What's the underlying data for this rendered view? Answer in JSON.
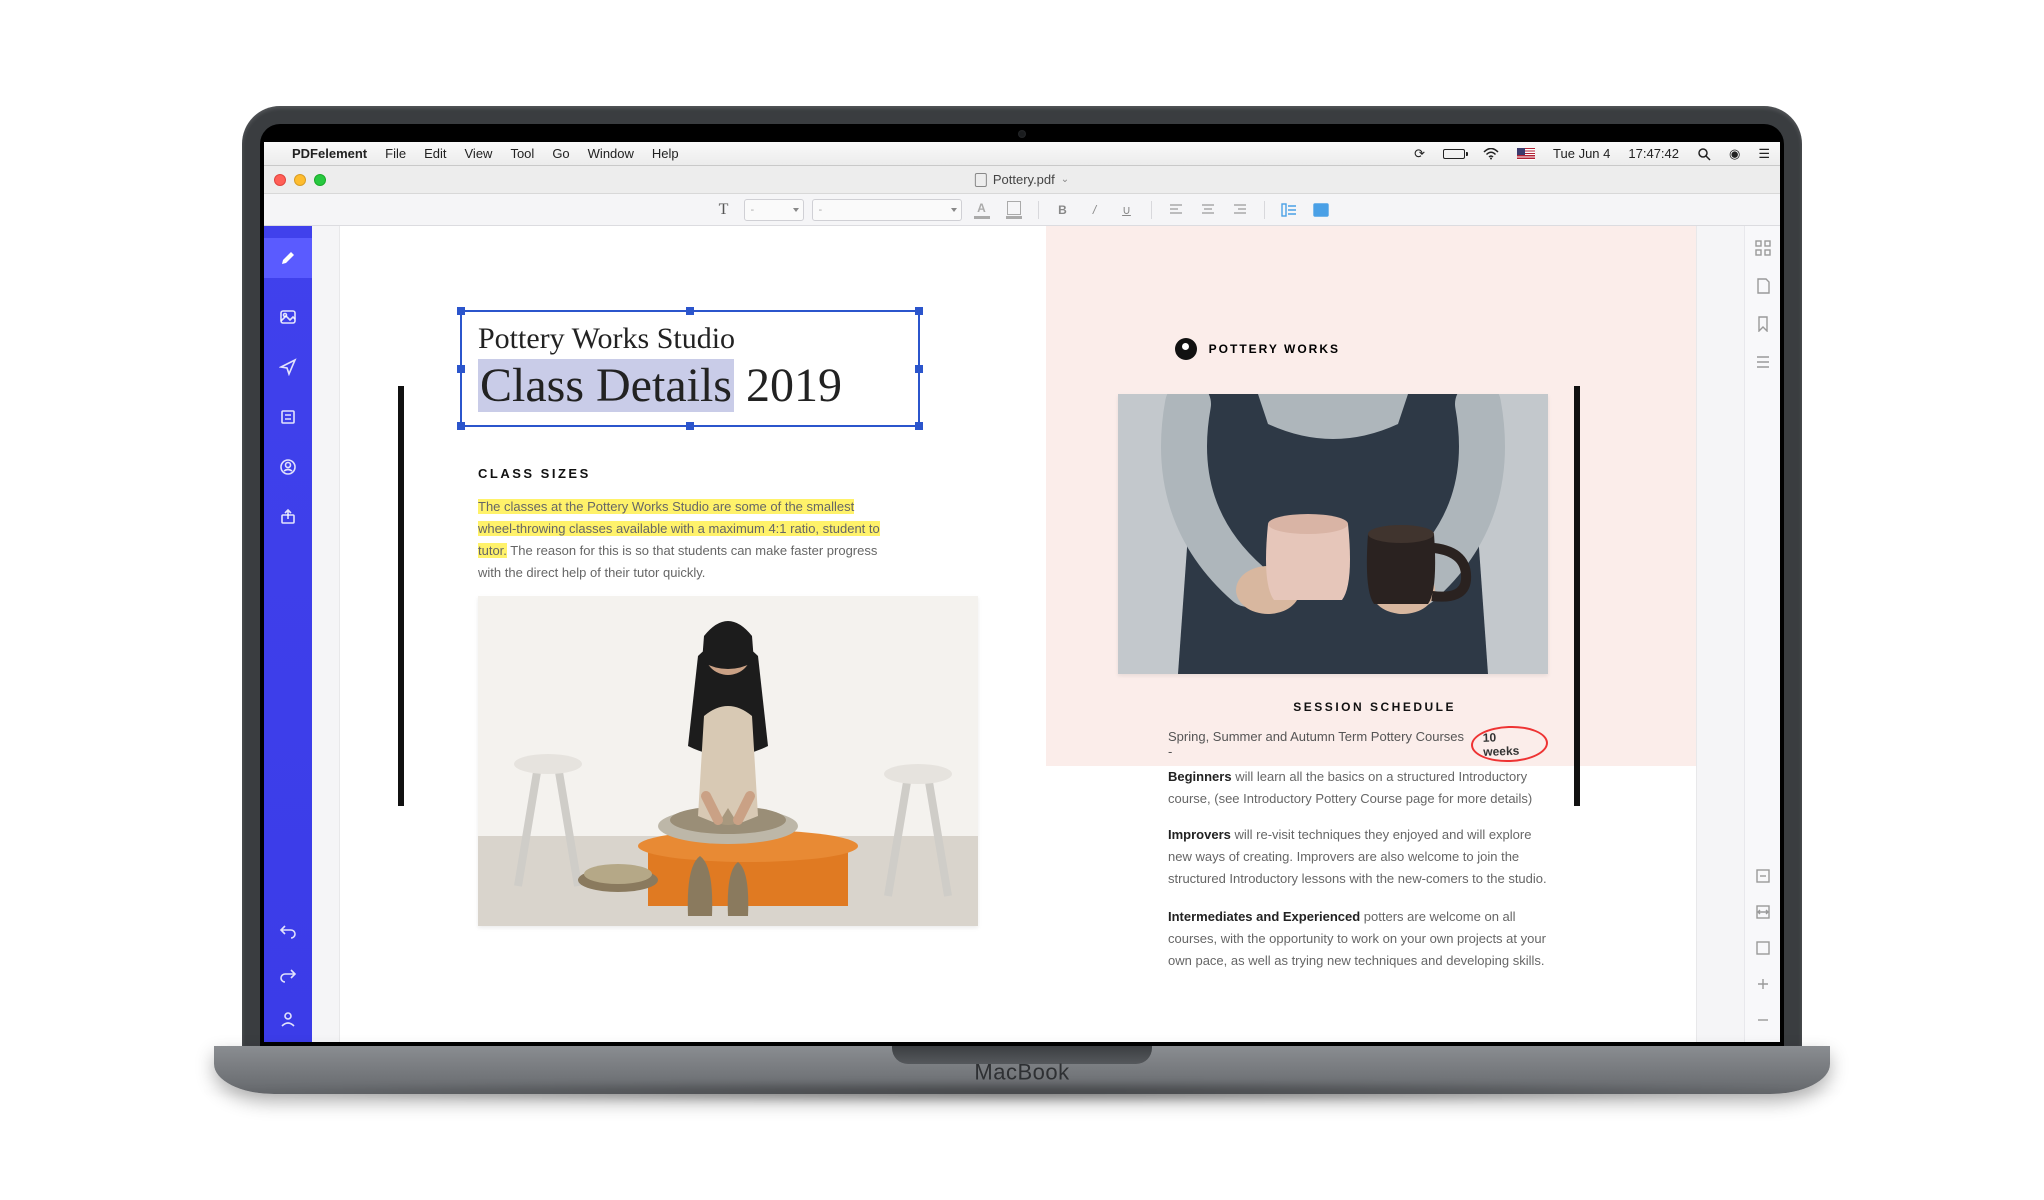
{
  "menubar": {
    "app": "PDFelement",
    "items": [
      "File",
      "Edit",
      "View",
      "Tool",
      "Go",
      "Window",
      "Help"
    ],
    "date": "Tue Jun 4",
    "time": "17:47:42"
  },
  "window": {
    "filename": "Pottery.pdf"
  },
  "toolbar": {
    "font_size_placeholder": "-",
    "font_family_placeholder": "-"
  },
  "document": {
    "studio_line": "Pottery Works Studio",
    "title_highlight": "Class Details",
    "title_year": " 2019",
    "brand": "POTTERY WORKS",
    "sections": {
      "class_sizes": {
        "heading": "CLASS SIZES",
        "highlighted": "The classes at the Pottery Works Studio are some of the smallest wheel-throwing classes available with a maximum 4:1 ratio, student to tutor.",
        "rest": " The reason for this is so that students can make faster progress with the direct help of their tutor quickly."
      },
      "session": {
        "heading": "SESSION SCHEDULE",
        "line": "Spring, Summer and Autumn Term Pottery Courses  -",
        "duration": "10 weeks",
        "beginners_label": "Beginners",
        "beginners_text": " will learn all the basics on a structured Introductory course, (see Introductory Pottery Course page for more details)",
        "improvers_label": "Improvers",
        "improvers_text": " will re-visit techniques they enjoyed and will explore new ways of creating. Improvers are also welcome to join the structured Introductory lessons with the new-comers to the studio.",
        "advanced_label": "Intermediates and Experienced",
        "advanced_text": " potters are welcome on all courses, with the opportunity to work on your own projects at your own pace, as well as trying new techniques and developing skills."
      }
    }
  },
  "laptop_label": "MacBook"
}
